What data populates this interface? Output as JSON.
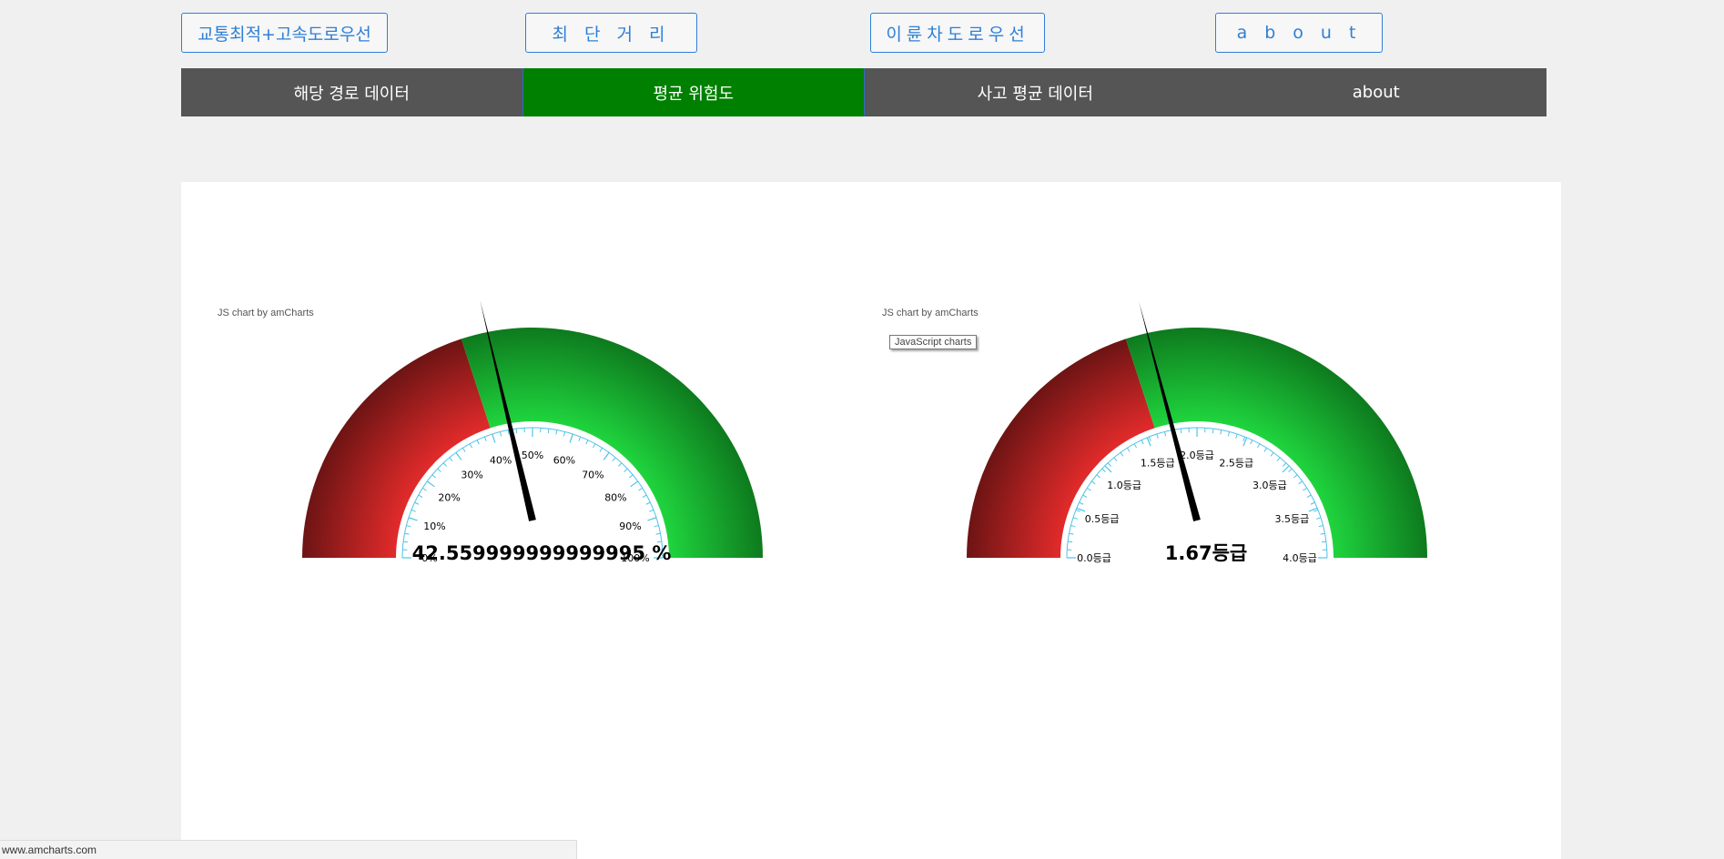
{
  "route_buttons": [
    {
      "label": "교통최적+고속도로우선"
    },
    {
      "label": "최단거리"
    },
    {
      "label": "이륜차도로우선"
    },
    {
      "label": "about"
    }
  ],
  "tabs": [
    {
      "label": "해당 경로 데이터",
      "active": false
    },
    {
      "label": "평균 위험도",
      "active": true
    },
    {
      "label": "사고 평균 데이터",
      "active": false
    },
    {
      "label": "about",
      "active": false
    }
  ],
  "credits": {
    "left": "JS chart by amCharts",
    "right": "JS chart by amCharts"
  },
  "tooltip": "JavaScript charts",
  "status_url": "www.amcharts.com",
  "colors": {
    "tab_bg": "#555555",
    "tab_active": "#008000",
    "button_border": "#2f7fd6",
    "band_red": "#c62828",
    "band_green": "#1ec93b",
    "axis_ticks": "#4fc3e6"
  },
  "chart_data": [
    {
      "type": "gauge",
      "min": 0,
      "max": 100,
      "ticks": [
        {
          "value": 0,
          "label": "0%"
        },
        {
          "value": 10,
          "label": "10%"
        },
        {
          "value": 20,
          "label": "20%"
        },
        {
          "value": 30,
          "label": "30%"
        },
        {
          "value": 40,
          "label": "40%"
        },
        {
          "value": 50,
          "label": "50%"
        },
        {
          "value": 60,
          "label": "60%"
        },
        {
          "value": 70,
          "label": "70%"
        },
        {
          "value": 80,
          "label": "80%"
        },
        {
          "value": 90,
          "label": "90%"
        },
        {
          "value": 100,
          "label": "100%"
        }
      ],
      "bands": [
        {
          "from": 0,
          "to": 40,
          "color": "red"
        },
        {
          "from": 40,
          "to": 100,
          "color": "green"
        }
      ],
      "value": 42.559999999999995,
      "value_label": "42.559999999999995 %"
    },
    {
      "type": "gauge",
      "min": 0,
      "max": 4,
      "ticks": [
        {
          "value": 0,
          "label": "0.0등급"
        },
        {
          "value": 0.5,
          "label": "0.5등급"
        },
        {
          "value": 1.0,
          "label": "1.0등급"
        },
        {
          "value": 1.5,
          "label": "1.5등급"
        },
        {
          "value": 2.0,
          "label": "2.0등급"
        },
        {
          "value": 2.5,
          "label": "2.5등급"
        },
        {
          "value": 3.0,
          "label": "3.0등급"
        },
        {
          "value": 3.5,
          "label": "3.5등급"
        },
        {
          "value": 4.0,
          "label": "4.0등급"
        }
      ],
      "bands": [
        {
          "from": 0,
          "to": 1.6,
          "color": "red"
        },
        {
          "from": 1.6,
          "to": 4,
          "color": "green"
        }
      ],
      "value": 1.67,
      "value_label": "1.67등급"
    }
  ]
}
